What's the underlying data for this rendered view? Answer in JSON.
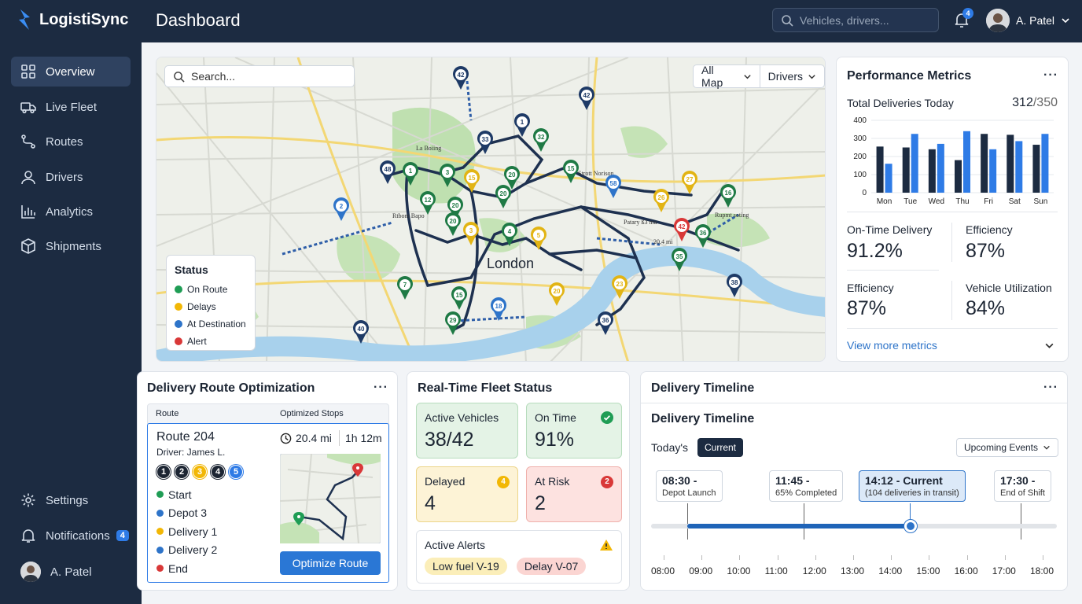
{
  "app": {
    "name": "LogistiSync",
    "page_title": "Dashboard"
  },
  "sidebar": {
    "items": [
      {
        "label": "Overview",
        "icon": "grid-icon"
      },
      {
        "label": "Live Fleet",
        "icon": "truck-icon"
      },
      {
        "label": "Routes",
        "icon": "route-icon"
      },
      {
        "label": "Drivers",
        "icon": "user-icon"
      },
      {
        "label": "Analytics",
        "icon": "bar-chart-icon"
      },
      {
        "label": "Shipments",
        "icon": "box-icon"
      }
    ],
    "settings_label": "Settings",
    "notifications_label": "Notifications",
    "notifications_count": "4",
    "user_name": "A. Patel"
  },
  "header": {
    "search_placeholder": "Vehicles, drivers...",
    "notification_count": "4",
    "user_name": "A. Patel"
  },
  "map": {
    "search_placeholder": "Search...",
    "filter_map": "All Map",
    "filter_drivers": "Drivers",
    "city_label": "London",
    "legend_title": "Status",
    "legend": [
      {
        "label": "On Route",
        "color": "#1f9d55"
      },
      {
        "label": "Delays",
        "color": "#f2b705"
      },
      {
        "label": "At Destination",
        "color": "#2e74c9"
      },
      {
        "label": "Alert",
        "color": "#d93838"
      }
    ],
    "place_labels": [
      "La Boiing",
      "Strott Norison",
      "Patary ß3 ma",
      "Rupmt soting",
      "Rtbom Bapo",
      "20.4 mi"
    ],
    "markers": [
      {
        "label": "42",
        "status": "navy"
      },
      {
        "label": "42",
        "status": "navy"
      },
      {
        "label": "1",
        "status": "navy"
      },
      {
        "label": "33",
        "status": "navy"
      },
      {
        "label": "32",
        "status": "green"
      },
      {
        "label": "48",
        "status": "navy"
      },
      {
        "label": "1",
        "status": "green"
      },
      {
        "label": "3",
        "status": "green"
      },
      {
        "label": "15",
        "status": "yellow"
      },
      {
        "label": "20",
        "status": "green"
      },
      {
        "label": "15",
        "status": "green"
      },
      {
        "label": "58",
        "status": "blue"
      },
      {
        "label": "27",
        "status": "yellow"
      },
      {
        "label": "16",
        "status": "green"
      },
      {
        "label": "2",
        "status": "blue"
      },
      {
        "label": "12",
        "status": "green"
      },
      {
        "label": "20",
        "status": "green"
      },
      {
        "label": "20",
        "status": "green"
      },
      {
        "label": "20",
        "status": "green"
      },
      {
        "label": "26",
        "status": "yellow"
      },
      {
        "label": "3",
        "status": "yellow"
      },
      {
        "label": "4",
        "status": "green"
      },
      {
        "label": "5",
        "status": "yellow"
      },
      {
        "label": "42",
        "status": "red"
      },
      {
        "label": "36",
        "status": "green"
      },
      {
        "label": "35",
        "status": "green"
      },
      {
        "label": "7",
        "status": "green"
      },
      {
        "label": "15",
        "status": "green"
      },
      {
        "label": "18",
        "status": "blue"
      },
      {
        "label": "20",
        "status": "yellow"
      },
      {
        "label": "23",
        "status": "yellow"
      },
      {
        "label": "38",
        "status": "navy"
      },
      {
        "label": "40",
        "status": "navy"
      },
      {
        "label": "29",
        "status": "green"
      },
      {
        "label": "36",
        "status": "navy"
      }
    ]
  },
  "performance": {
    "title": "Performance Metrics",
    "total_label": "Total Deliveries Today",
    "total_value": "312",
    "total_target": "/350",
    "metrics": [
      {
        "label": "On-Time Delivery",
        "value": "91.2%"
      },
      {
        "label": "Efficiency",
        "value": "87%"
      },
      {
        "label": "Efficiency",
        "value": "87%"
      },
      {
        "label": "Vehicle Utilization",
        "value": "84%"
      }
    ],
    "view_more": "View more metrics"
  },
  "chart_data": {
    "type": "bar",
    "categories": [
      "Mon",
      "Tue",
      "Wed",
      "Thu",
      "Fri",
      "Sat",
      "Sun"
    ],
    "series": [
      {
        "values": [
          255,
          250,
          240,
          180,
          325,
          320,
          265
        ]
      },
      {
        "values": [
          160,
          325,
          270,
          340,
          240,
          285,
          325
        ]
      }
    ],
    "ylim": [
      0,
      400
    ],
    "yticks": [
      "400",
      "300",
      "200",
      "100",
      "0"
    ],
    "colors": [
      "#1c2b41",
      "#2e7be6"
    ]
  },
  "route": {
    "title": "Delivery Route Optimization",
    "col_route": "Route",
    "col_stops": "Optimized Stops",
    "route_name": "Route 204",
    "driver": "Driver: James L.",
    "distance": "20.4 mi",
    "duration": "1h 12m",
    "step_badges": [
      "1",
      "2",
      "3",
      "4",
      "5"
    ],
    "stops": [
      {
        "label": "Start",
        "color": "#1f9d55"
      },
      {
        "label": "Depot 3",
        "color": "#2e74c9"
      },
      {
        "label": "Delivery 1",
        "color": "#f2b705"
      },
      {
        "label": "Delivery 2",
        "color": "#2e74c9"
      },
      {
        "label": "End",
        "color": "#d93838"
      }
    ],
    "button": "Optimize Route"
  },
  "fleet": {
    "title": "Real-Time Fleet Status",
    "active_label": "Active Vehicles",
    "active_value": "38/42",
    "ontime_label": "On Time",
    "ontime_value": "91%",
    "delayed_label": "Delayed",
    "delayed_value": "4",
    "delayed_badge": "4",
    "risk_label": "At Risk",
    "risk_value": "2",
    "risk_badge": "2",
    "alerts_label": "Active Alerts",
    "alerts": [
      "Low fuel V-19",
      "Delay V-07"
    ]
  },
  "timeline": {
    "title": "Delivery Timeline",
    "subtitle": "Delivery Timeline",
    "today_label": "Today's",
    "current_button": "Current",
    "dropdown": "Upcoming Events",
    "events": [
      {
        "time": "08:30 -",
        "desc": "Depot Launch"
      },
      {
        "time": "11:45 -",
        "desc": "65% Completed"
      },
      {
        "time": "14:12 - Current",
        "desc": "(104 deliveries in transit)"
      },
      {
        "time": "17:30 -",
        "desc": "End of Shift"
      }
    ],
    "axis": [
      "08:00",
      "09:00",
      "10:00",
      "11:00",
      "12:00",
      "13:00",
      "14:00",
      "15:00",
      "16:00",
      "17:00",
      "18:00"
    ],
    "progress": 0.62
  }
}
